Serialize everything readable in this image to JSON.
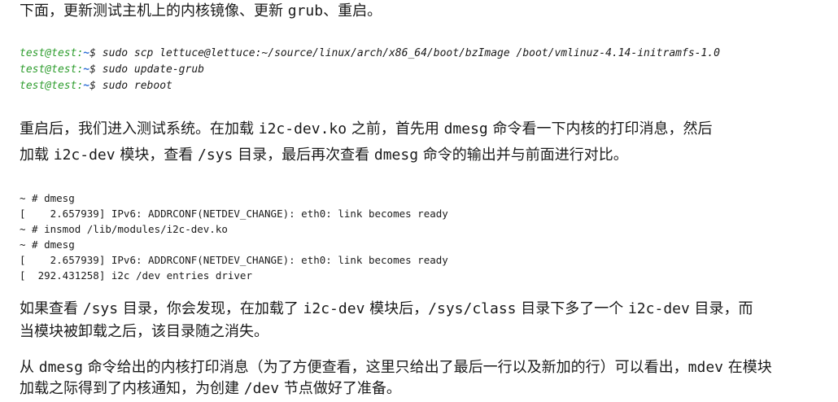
{
  "intro": {
    "before": "下面，更新测试主机上的内核镜像、更新 ",
    "code": "grub",
    "after": "、重启。"
  },
  "terminal": [
    {
      "user": "test@test",
      "path": "~",
      "cmd": " sudo scp lettuce@lettuce:~/source/linux/arch/x86_64/boot/bzImage /boot/vmlinuz-4.14-initramfs-1.0"
    },
    {
      "user": "test@test",
      "path": "~",
      "cmd": " sudo update-grub"
    },
    {
      "user": "test@test",
      "path": "~",
      "cmd": " sudo reboot"
    }
  ],
  "para2": {
    "line1": {
      "t1": "重启后，我们进入测试系统。在加载 ",
      "c1": "i2c-dev.ko",
      "t2": " 之前，首先用 ",
      "c2": "dmesg",
      "t3": " 命令看一下内核的打印消息，然后"
    },
    "line2": {
      "t1": "加载 ",
      "c1": "i2c-dev",
      "t2": " 模块，查看 ",
      "c2": "/sys",
      "t3": " 目录，最后再次查看 ",
      "c3": "dmesg",
      "t4": " 命令的输出并与前面进行对比。"
    }
  },
  "shell_lines": [
    "~ # dmesg",
    "[    2.657939] IPv6: ADDRCONF(NETDEV_CHANGE): eth0: link becomes ready",
    "~ # insmod /lib/modules/i2c-dev.ko",
    "~ # dmesg",
    "[    2.657939] IPv6: ADDRCONF(NETDEV_CHANGE): eth0: link becomes ready",
    "[  292.431258] i2c /dev entries driver"
  ],
  "para3": {
    "line1": {
      "t1": "如果查看 ",
      "c1": "/sys",
      "t2": " 目录，你会发现，在加载了 ",
      "c2": "i2c-dev",
      "t3": " 模块后，",
      "c3": "/sys/class",
      "t4": " 目录下多了一个 ",
      "c4": "i2c-dev",
      "t5": " 目录，而"
    },
    "line2": "当模块被卸载之后，该目录随之消失。"
  },
  "para4": {
    "line1": {
      "t1": "从 ",
      "c1": "dmesg",
      "t2": " 命令给出的内核打印消息（为了方便查看，这里只给出了最后一行以及新加的行）可以看出，",
      "c2": "mdev",
      "t3": " 在模块"
    },
    "line2": {
      "t1": "加载之际得到了内核通知，为创建 ",
      "c1": "/dev",
      "t2": " 节点做好了准备。"
    }
  }
}
